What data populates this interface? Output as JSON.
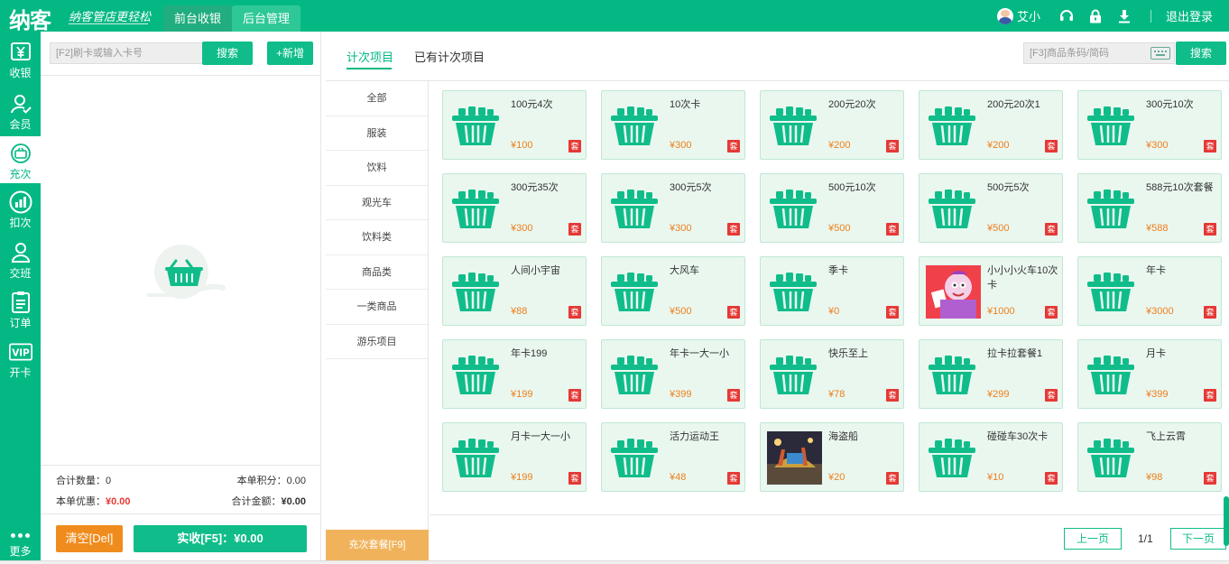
{
  "header": {
    "logo": "纳客",
    "slogan": "纳客管店更轻松",
    "tabs": [
      {
        "label": "前台收银",
        "active": true
      },
      {
        "label": "后台管理",
        "active": false
      }
    ],
    "user_name": "艾小",
    "logout_label": "退出登录",
    "icons": [
      "user-avatar",
      "headset-icon",
      "lock-icon",
      "download-icon"
    ]
  },
  "sidebar": {
    "items": [
      {
        "label": "收银",
        "icon": "yen-icon"
      },
      {
        "label": "会员",
        "icon": "member-icon"
      },
      {
        "label": "充次",
        "icon": "recharge-icon",
        "active": true
      },
      {
        "label": "扣次",
        "icon": "chart-icon"
      },
      {
        "label": "交班",
        "icon": "shift-icon"
      },
      {
        "label": "订单",
        "icon": "order-icon"
      },
      {
        "label": "开卡",
        "icon": "vip-icon"
      }
    ],
    "more_label": "更多"
  },
  "left": {
    "card_placeholder": "[F2]刷卡或输入卡号",
    "search_label": "搜索",
    "add_label": "+新增",
    "total_qty_label": "合计数量：",
    "total_qty": "0",
    "points_label": "本单积分：",
    "points": "0.00",
    "discount_label": "本单优惠：",
    "discount": "¥0.00",
    "total_amount_label": "合计金额：",
    "total_amount": "¥0.00",
    "clear_label": "清空[Del]",
    "pay_label": "实收[F5]：¥0.00"
  },
  "right": {
    "tabs": [
      {
        "label": "计次项目",
        "active": true
      },
      {
        "label": "已有计次项目",
        "active": false
      }
    ],
    "code_placeholder": "[F3]商品条码/简码",
    "search_label": "搜索",
    "categories": [
      "全部",
      "服装",
      "饮料",
      "观光车",
      "饮料类",
      "商品类",
      "一类商品",
      "游乐项目"
    ],
    "category_footer": "充次套餐[F9]",
    "items": [
      {
        "name": "100元4次",
        "price": "¥100",
        "tag": "套",
        "image": "basket"
      },
      {
        "name": "10次卡",
        "price": "¥300",
        "tag": "套",
        "image": "basket"
      },
      {
        "name": "200元20次",
        "price": "¥200",
        "tag": "套",
        "image": "basket"
      },
      {
        "name": "200元20次1",
        "price": "¥200",
        "tag": "套",
        "image": "basket"
      },
      {
        "name": "300元10次",
        "price": "¥300",
        "tag": "套",
        "image": "basket"
      },
      {
        "name": "300元35次",
        "price": "¥300",
        "tag": "套",
        "image": "basket"
      },
      {
        "name": "300元5次",
        "price": "¥300",
        "tag": "套",
        "image": "basket"
      },
      {
        "name": "500元10次",
        "price": "¥500",
        "tag": "套",
        "image": "basket"
      },
      {
        "name": "500元5次",
        "price": "¥500",
        "tag": "套",
        "image": "basket"
      },
      {
        "name": "588元10次套餐",
        "price": "¥588",
        "tag": "套",
        "image": "basket"
      },
      {
        "name": "人间小宇宙",
        "price": "¥88",
        "tag": "套",
        "image": "basket"
      },
      {
        "name": "大风车",
        "price": "¥500",
        "tag": "套",
        "image": "basket"
      },
      {
        "name": "季卡",
        "price": "¥0",
        "tag": "套",
        "image": "basket"
      },
      {
        "name": "小小小火车10次卡",
        "price": "¥1000",
        "tag": "套",
        "image": "cartoon"
      },
      {
        "name": "年卡",
        "price": "¥3000",
        "tag": "套",
        "image": "basket"
      },
      {
        "name": "年卡199",
        "price": "¥199",
        "tag": "套",
        "image": "basket"
      },
      {
        "name": "年卡一大一小",
        "price": "¥399",
        "tag": "套",
        "image": "basket"
      },
      {
        "name": "快乐至上",
        "price": "¥78",
        "tag": "套",
        "image": "basket"
      },
      {
        "name": "拉卡拉套餐1",
        "price": "¥299",
        "tag": "套",
        "image": "basket"
      },
      {
        "name": "月卡",
        "price": "¥399",
        "tag": "套",
        "image": "basket"
      },
      {
        "name": "月卡一大一小",
        "price": "¥199",
        "tag": "套",
        "image": "basket"
      },
      {
        "name": "活力运动王",
        "price": "¥48",
        "tag": "套",
        "image": "basket"
      },
      {
        "name": "海盗船",
        "price": "¥20",
        "tag": "套",
        "image": "photo"
      },
      {
        "name": "碰碰车30次卡",
        "price": "¥10",
        "tag": "套",
        "image": "basket"
      },
      {
        "name": "飞上云霄",
        "price": "¥98",
        "tag": "套",
        "image": "basket"
      }
    ],
    "pagination": {
      "prev_label": "上一页",
      "next_label": "下一页",
      "page_info": "1/1"
    }
  },
  "colors": {
    "brand": "#04b884",
    "price": "#f07e1a",
    "tag": "#e53935",
    "clear": "#f08c1e",
    "category_footer": "#f0b35c"
  }
}
